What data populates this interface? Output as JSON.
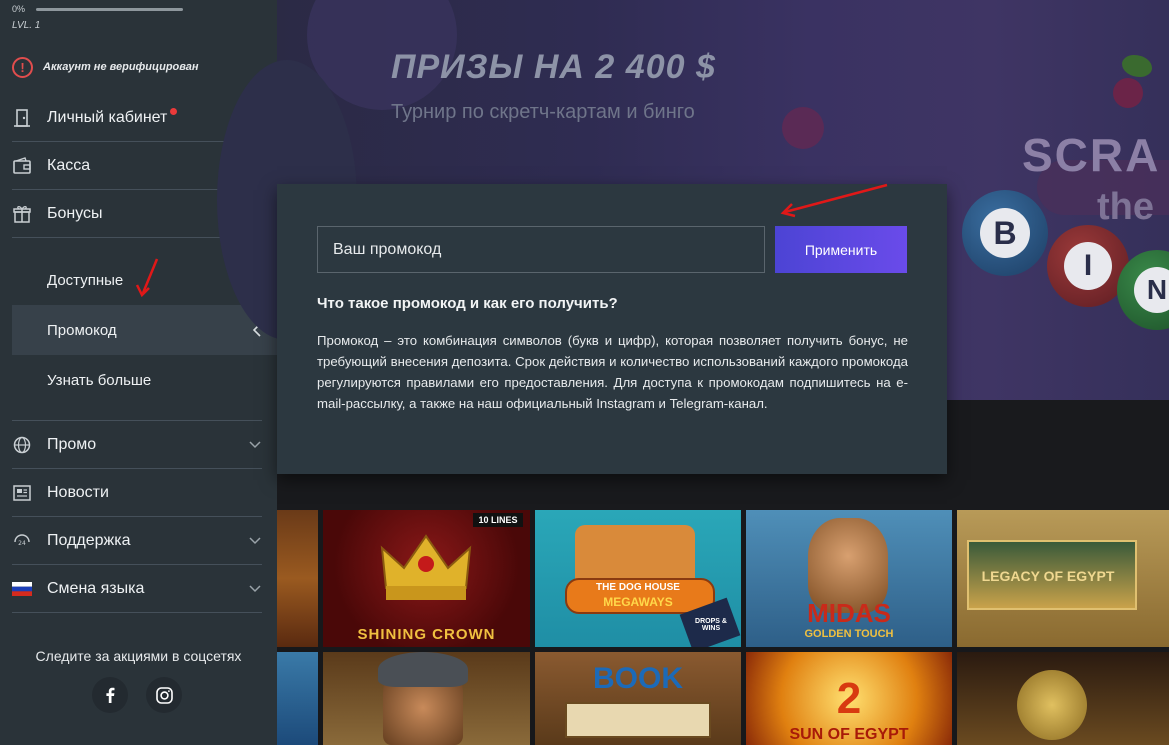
{
  "level": {
    "percent_text": "0%",
    "label": "LVL. 1",
    "progress": 0
  },
  "account_status": "Аккаунт не верифицирован",
  "menu": {
    "cabinet": "Личный кабинет",
    "cashier": "Касса",
    "bonuses": "Бонусы",
    "bonus_sub": {
      "available": "Доступные",
      "promocode": "Промокод",
      "learn_more": "Узнать больше"
    },
    "promo": "Промо",
    "news": "Новости",
    "support": "Поддержка",
    "language": "Смена языка"
  },
  "social": {
    "text": "Следите за акциями в соцсетях"
  },
  "banner": {
    "title": "ПРИЗЫ НА 2 400 $",
    "subtitle": "Турнир по скретч-картам и бинго",
    "art_word_1": "SCRA",
    "art_word_2": "the",
    "bingo_letters": [
      "B",
      "I",
      "N"
    ]
  },
  "promo_panel": {
    "input_placeholder": "Ваш промокод",
    "apply_label": "Применить",
    "question": "Что такое промокод и как его получить?",
    "description": "Промокод – это комбинация символов (букв и цифр), которая позволяет получить бонус, не требующий внесения депозита. Срок действия и количество использований каждого промокода регулируются правилами его предоставления. Для доступа к промокодам подпишитесь на e-mail-рассылку, а также на наш официальный Instagram и Telegram-канал."
  },
  "games": {
    "shining_crown": "SHINING CROWN",
    "shining_badge": "10 LINES",
    "dog_house_1": "THE DOG HOUSE",
    "dog_house_2": "MEGAWAYS",
    "drops_wins": "DROPS & WINS",
    "midas_1": "MIDAS",
    "midas_2": "GOLDEN TOUCH",
    "legacy": "LEGACY OF EGYPT",
    "book": "BOOK",
    "sun_2": "2",
    "sun_1": "SUN OF EGYPT"
  },
  "colors": {
    "sidebar": "#2a3339",
    "panel": "#2c3840",
    "accent": "#5a47e0",
    "alert": "#e14d4d"
  }
}
